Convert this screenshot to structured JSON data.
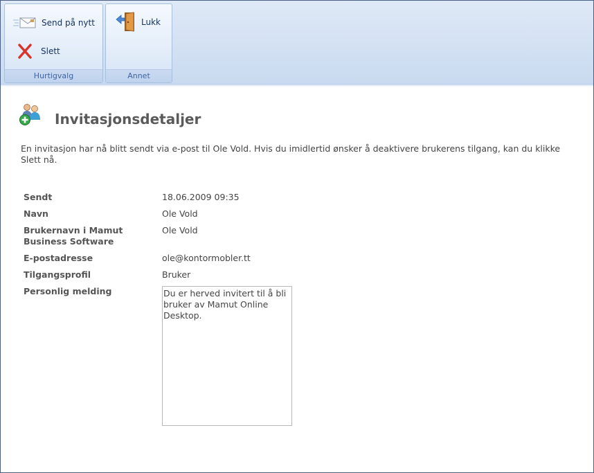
{
  "ribbon": {
    "groups": [
      {
        "label": "Hurtigvalg",
        "buttons": [
          {
            "label": "Send på nytt",
            "icon": "envelope-icon"
          },
          {
            "label": "Slett",
            "icon": "red-x-icon"
          }
        ]
      },
      {
        "label": "Annet",
        "buttons": [
          {
            "label": "Lukk",
            "icon": "door-exit-icon"
          }
        ]
      }
    ]
  },
  "main": {
    "title": "Invitasjonsdetaljer",
    "title_icon": "users-add-icon",
    "intro": "En invitasjon har nå blitt sendt via e-post til Ole Vold. Hvis du imidlertid ønsker å deaktivere brukerens tilgang, kan du klikke Slett nå.",
    "fields": {
      "sent": {
        "label": "Sendt",
        "value": "18.06.2009 09:35"
      },
      "name": {
        "label": "Navn",
        "value": "Ole Vold"
      },
      "username": {
        "label": "Brukernavn i Mamut Business Software",
        "value": "Ole Vold"
      },
      "email": {
        "label": "E-postadresse",
        "value": "ole@kontormobler.tt"
      },
      "profile": {
        "label": "Tilgangsprofil",
        "value": "Bruker"
      },
      "message": {
        "label": "Personlig melding",
        "value": "Du er herved invitert til å bli bruker av Mamut Online Desktop."
      }
    }
  },
  "colors": {
    "ribbon_text": "#15315f",
    "group_label": "#3e64a0",
    "title": "#5a5a5a"
  }
}
